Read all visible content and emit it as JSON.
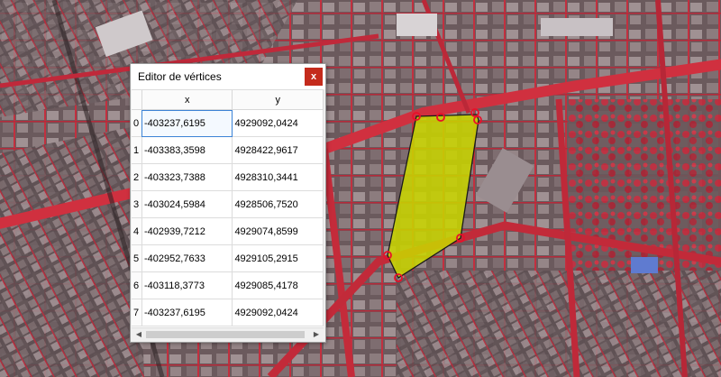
{
  "window": {
    "title": "Editor de vértices",
    "close_label": "x"
  },
  "table": {
    "columns": [
      "x",
      "y"
    ],
    "rows": [
      {
        "index": "0",
        "x": "-403237,6195",
        "y": "4929092,0424"
      },
      {
        "index": "1",
        "x": "-403383,3598",
        "y": "4928422,9617"
      },
      {
        "index": "2",
        "x": "-403323,7388",
        "y": "4928310,3441"
      },
      {
        "index": "3",
        "x": "-403024,5984",
        "y": "4928506,7520"
      },
      {
        "index": "4",
        "x": "-402939,7212",
        "y": "4929074,8599"
      },
      {
        "index": "5",
        "x": "-402952,7633",
        "y": "4929105,2915"
      },
      {
        "index": "6",
        "x": "-403118,3773",
        "y": "4929085,4178"
      },
      {
        "index": "7",
        "x": "-403237,6195",
        "y": "4929092,0424"
      }
    ]
  },
  "scrollbar": {
    "left_arrow": "◀",
    "right_arrow": "▶"
  },
  "colors": {
    "polygon_fill": "#c8d400",
    "vertex_marker": "#e8102a",
    "imagery_red": "#c8283a"
  }
}
